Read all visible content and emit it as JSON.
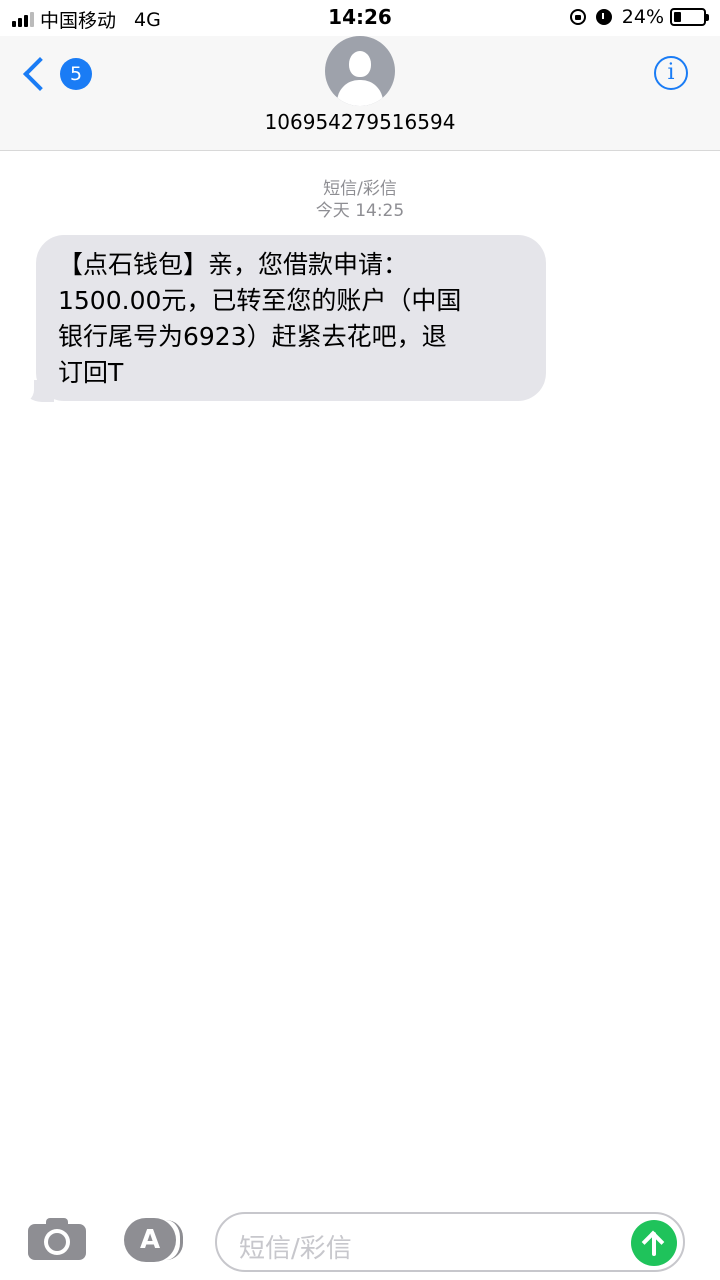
{
  "status_bar": {
    "carrier": "中国移动",
    "network": "4G",
    "time": "14:26",
    "battery_percent": "24%",
    "battery_level": 0.24
  },
  "header": {
    "back_badge_count": "5",
    "contact_number": "106954279516594",
    "accent_color": "#1a7cf5"
  },
  "conversation": {
    "service_label": "短信/彩信",
    "timestamp": "今天 14:25",
    "messages": [
      {
        "lines": [
          "【点石钱包】亲，您借款申请：",
          "1500.00元，已转至您的账户（中国",
          "银行尾号为6923）赶紧去花吧，退",
          "订回T"
        ]
      }
    ]
  },
  "composer": {
    "placeholder": "短信/彩信",
    "send_color": "#1fc35b"
  }
}
